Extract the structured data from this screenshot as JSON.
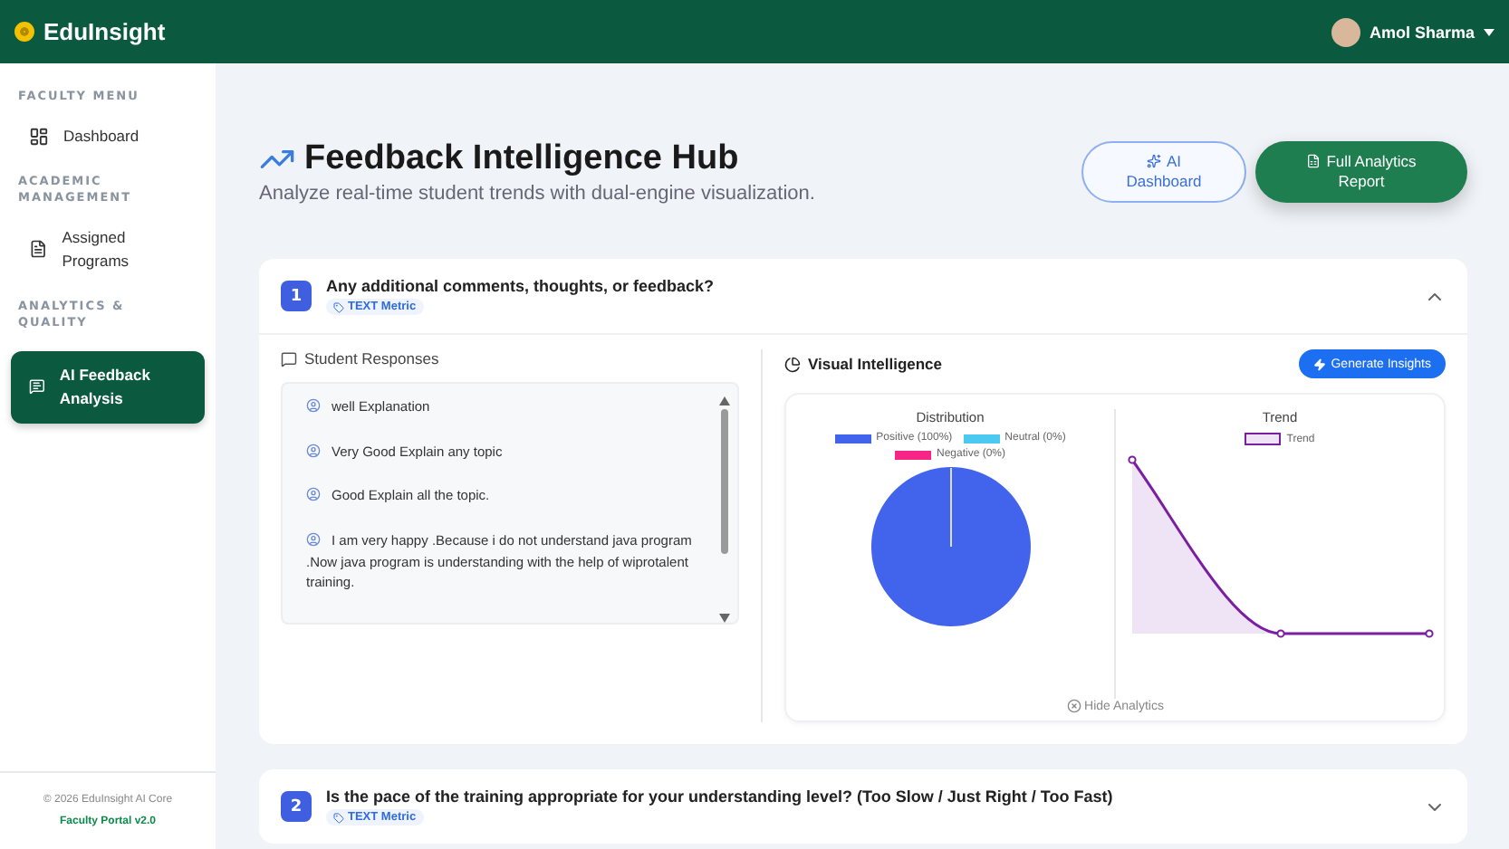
{
  "brand": "EduInsight",
  "user": {
    "name": "Amol Sharma"
  },
  "sidebar": {
    "sections": [
      {
        "heading": "FACULTY MENU",
        "items": [
          {
            "label": "Dashboard",
            "selected": false
          }
        ]
      },
      {
        "heading": "ACADEMIC MANAGEMENT",
        "items": [
          {
            "label": "Assigned Programs",
            "selected": false
          }
        ]
      },
      {
        "heading": "ANALYTICS & QUALITY",
        "items": [
          {
            "label": "AI Feedback Analysis",
            "selected": true
          }
        ]
      }
    ],
    "footer": "© 2026 EduInsight AI Core",
    "version": "Faculty Portal v2.0"
  },
  "page": {
    "title": "Feedback Intelligence Hub",
    "subtitle": "Analyze real-time student trends with dual-engine visualization.",
    "buttons": [
      {
        "label": "AI Dashboard",
        "kind": "outline"
      },
      {
        "label": "Full Analytics Report",
        "kind": "solid"
      }
    ]
  },
  "questions": [
    {
      "number": "1",
      "text": "Any additional comments, thoughts, or feedback?",
      "tag": "TEXT Metric",
      "expanded": true,
      "responses_title": "Student Responses",
      "responses": [
        "well Explanation",
        "Very Good Explain any topic",
        "Good Explain all the topic.",
        "I am very happy .Because i do not understand java program .Now java program is understanding with the help of wiprotalent training."
      ],
      "visual_title": "Visual Intelligence",
      "insights_button": "Generate Insights",
      "distribution": {
        "title": "Distribution",
        "legend": [
          {
            "label": "Positive (100%)",
            "color": "#4263eb"
          },
          {
            "label": "Neutral (0%)",
            "color": "#4cc9f0"
          },
          {
            "label": "Negative (0%)",
            "color": "#f72585"
          }
        ]
      },
      "trend": {
        "title": "Trend",
        "legend": "Trend"
      },
      "hide_label": "Hide Analytics"
    },
    {
      "number": "2",
      "text": "Is the pace of the training appropriate for your understanding level? (Too Slow / Just Right / Too Fast)",
      "tag": "TEXT Metric",
      "expanded": false
    }
  ]
}
